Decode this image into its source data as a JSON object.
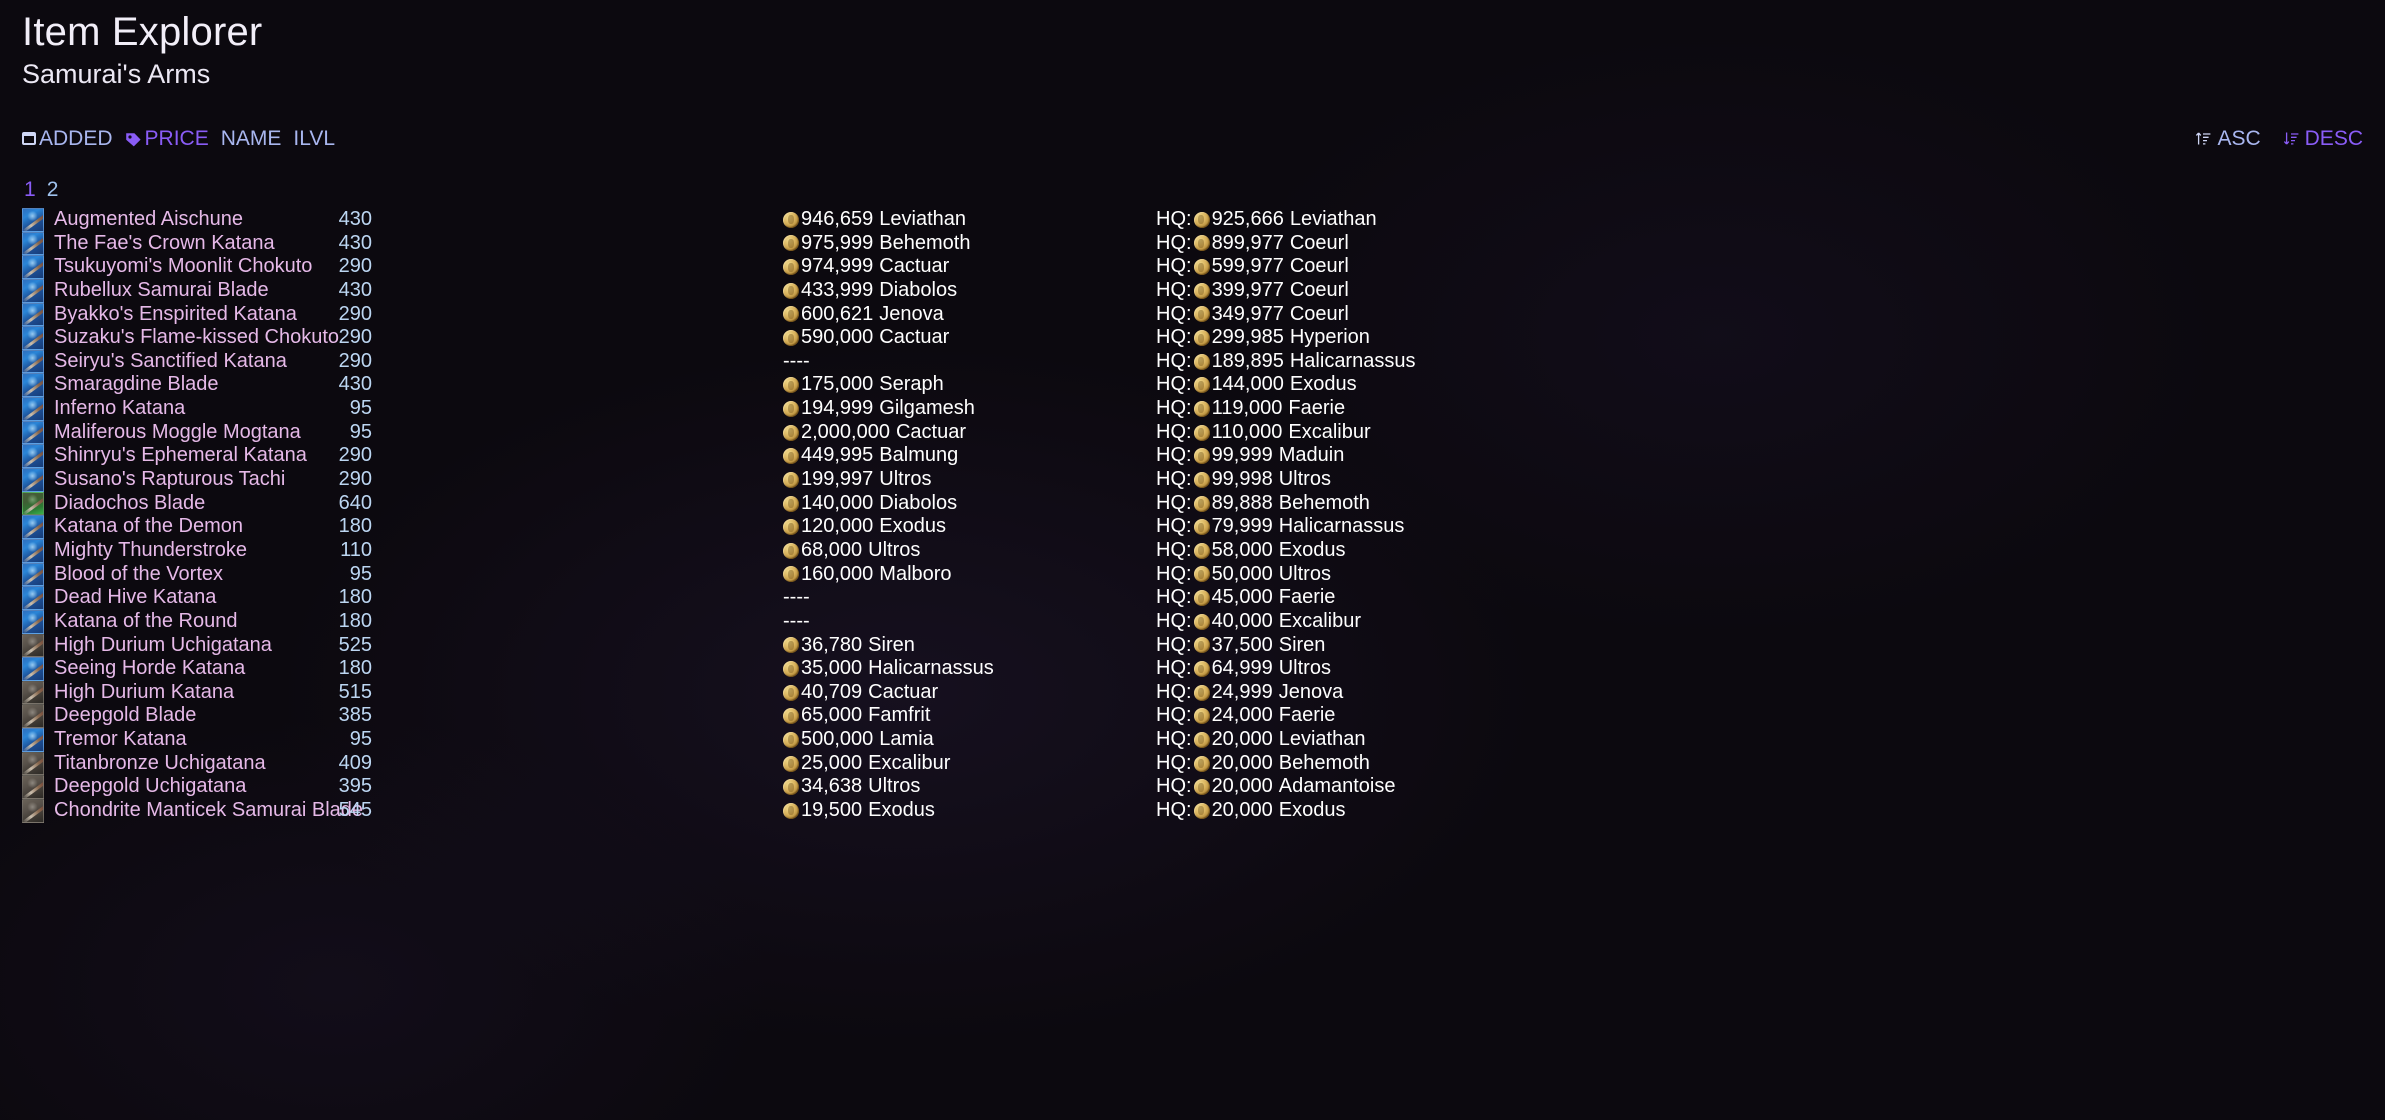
{
  "header": {
    "title": "Item Explorer",
    "subtitle": "Samurai's Arms"
  },
  "sort": {
    "options": [
      {
        "label": "ADDED",
        "icon": "calendar-icon",
        "active": false
      },
      {
        "label": "PRICE",
        "icon": "price-tag-icon",
        "active": true
      },
      {
        "label": "NAME",
        "icon": "",
        "active": false
      },
      {
        "label": "ILVL",
        "icon": "",
        "active": false
      }
    ],
    "directions": [
      {
        "label": "ASC",
        "icon": "sort-ascending-icon",
        "active": false
      },
      {
        "label": "DESC",
        "icon": "sort-descending-icon",
        "active": true
      }
    ]
  },
  "pagination": {
    "pages": [
      {
        "label": "1",
        "current": true
      },
      {
        "label": "2",
        "current": false
      }
    ]
  },
  "list": {
    "rows": [
      {
        "name": "Augmented Aischune",
        "ilvl": "430",
        "icon_tone": "blue",
        "price": {
          "value": "946,659",
          "server": "Leviathan"
        },
        "hq": {
          "prefix": "HQ:",
          "value": "925,666",
          "server": "Leviathan"
        }
      },
      {
        "name": "The Fae's Crown Katana",
        "ilvl": "430",
        "icon_tone": "blue",
        "price": {
          "value": "975,999",
          "server": "Behemoth"
        },
        "hq": {
          "prefix": "HQ:",
          "value": "899,977",
          "server": "Coeurl"
        }
      },
      {
        "name": "Tsukuyomi's Moonlit Chokuto",
        "ilvl": "290",
        "icon_tone": "blue",
        "price": {
          "value": "974,999",
          "server": "Cactuar"
        },
        "hq": {
          "prefix": "HQ:",
          "value": "599,977",
          "server": "Coeurl"
        }
      },
      {
        "name": "Rubellux Samurai Blade",
        "ilvl": "430",
        "icon_tone": "blue",
        "price": {
          "value": "433,999",
          "server": "Diabolos"
        },
        "hq": {
          "prefix": "HQ:",
          "value": "399,977",
          "server": "Coeurl"
        }
      },
      {
        "name": "Byakko's Enspirited Katana",
        "ilvl": "290",
        "icon_tone": "blue",
        "price": {
          "value": "600,621",
          "server": "Jenova"
        },
        "hq": {
          "prefix": "HQ:",
          "value": "349,977",
          "server": "Coeurl"
        }
      },
      {
        "name": "Suzaku's Flame-kissed Chokuto",
        "ilvl": "290",
        "icon_tone": "blue",
        "price": {
          "value": "590,000",
          "server": "Cactuar"
        },
        "hq": {
          "prefix": "HQ:",
          "value": "299,985",
          "server": "Hyperion"
        }
      },
      {
        "name": "Seiryu's Sanctified Katana",
        "ilvl": "290",
        "icon_tone": "blue",
        "price": {
          "empty": "----"
        },
        "hq": {
          "prefix": "HQ:",
          "value": "189,895",
          "server": "Halicarnassus"
        }
      },
      {
        "name": "Smaragdine Blade",
        "ilvl": "430",
        "icon_tone": "blue",
        "price": {
          "value": "175,000",
          "server": "Seraph"
        },
        "hq": {
          "prefix": "HQ:",
          "value": "144,000",
          "server": "Exodus"
        }
      },
      {
        "name": "Inferno Katana",
        "ilvl": "95",
        "icon_tone": "blue",
        "price": {
          "value": "194,999",
          "server": "Gilgamesh"
        },
        "hq": {
          "prefix": "HQ:",
          "value": "119,000",
          "server": "Faerie"
        }
      },
      {
        "name": "Maliferous Moggle Mogtana",
        "ilvl": "95",
        "icon_tone": "blue",
        "price": {
          "value": "2,000,000",
          "server": "Cactuar"
        },
        "hq": {
          "prefix": "HQ:",
          "value": "110,000",
          "server": "Excalibur"
        }
      },
      {
        "name": "Shinryu's Ephemeral Katana",
        "ilvl": "290",
        "icon_tone": "blue",
        "price": {
          "value": "449,995",
          "server": "Balmung"
        },
        "hq": {
          "prefix": "HQ:",
          "value": "99,999",
          "server": "Maduin"
        }
      },
      {
        "name": "Susano's Rapturous Tachi",
        "ilvl": "290",
        "icon_tone": "blue",
        "price": {
          "value": "199,997",
          "server": "Ultros"
        },
        "hq": {
          "prefix": "HQ:",
          "value": "99,998",
          "server": "Ultros"
        }
      },
      {
        "name": "Diadochos Blade",
        "ilvl": "640",
        "icon_tone": "green",
        "price": {
          "value": "140,000",
          "server": "Diabolos"
        },
        "hq": {
          "prefix": "HQ:",
          "value": "89,888",
          "server": "Behemoth"
        }
      },
      {
        "name": "Katana of the Demon",
        "ilvl": "180",
        "icon_tone": "blue",
        "price": {
          "value": "120,000",
          "server": "Exodus"
        },
        "hq": {
          "prefix": "HQ:",
          "value": "79,999",
          "server": "Halicarnassus"
        }
      },
      {
        "name": "Mighty Thunderstroke",
        "ilvl": "110",
        "icon_tone": "blue",
        "price": {
          "value": "68,000",
          "server": "Ultros"
        },
        "hq": {
          "prefix": "HQ:",
          "value": "58,000",
          "server": "Exodus"
        }
      },
      {
        "name": "Blood of the Vortex",
        "ilvl": "95",
        "icon_tone": "blue",
        "price": {
          "value": "160,000",
          "server": "Malboro"
        },
        "hq": {
          "prefix": "HQ:",
          "value": "50,000",
          "server": "Ultros"
        }
      },
      {
        "name": "Dead Hive Katana",
        "ilvl": "180",
        "icon_tone": "blue",
        "price": {
          "empty": "----"
        },
        "hq": {
          "prefix": "HQ:",
          "value": "45,000",
          "server": "Faerie"
        }
      },
      {
        "name": "Katana of the Round",
        "ilvl": "180",
        "icon_tone": "blue",
        "price": {
          "empty": "----"
        },
        "hq": {
          "prefix": "HQ:",
          "value": "40,000",
          "server": "Excalibur"
        }
      },
      {
        "name": "High Durium Uchigatana",
        "ilvl": "525",
        "icon_tone": "gray",
        "price": {
          "value": "36,780",
          "server": "Siren"
        },
        "hq": {
          "prefix": "HQ:",
          "value": "37,500",
          "server": "Siren"
        }
      },
      {
        "name": "Seeing Horde Katana",
        "ilvl": "180",
        "icon_tone": "blue",
        "price": {
          "value": "35,000",
          "server": "Halicarnassus"
        },
        "hq": {
          "prefix": "HQ:",
          "value": "64,999",
          "server": "Ultros"
        }
      },
      {
        "name": "High Durium Katana",
        "ilvl": "515",
        "icon_tone": "gray",
        "price": {
          "value": "40,709",
          "server": "Cactuar"
        },
        "hq": {
          "prefix": "HQ:",
          "value": "24,999",
          "server": "Jenova"
        }
      },
      {
        "name": "Deepgold Blade",
        "ilvl": "385",
        "icon_tone": "gray",
        "price": {
          "value": "65,000",
          "server": "Famfrit"
        },
        "hq": {
          "prefix": "HQ:",
          "value": "24,000",
          "server": "Faerie"
        }
      },
      {
        "name": "Tremor Katana",
        "ilvl": "95",
        "icon_tone": "blue",
        "price": {
          "value": "500,000",
          "server": "Lamia"
        },
        "hq": {
          "prefix": "HQ:",
          "value": "20,000",
          "server": "Leviathan"
        }
      },
      {
        "name": "Titanbronze Uchigatana",
        "ilvl": "409",
        "icon_tone": "gray",
        "price": {
          "value": "25,000",
          "server": "Excalibur"
        },
        "hq": {
          "prefix": "HQ:",
          "value": "20,000",
          "server": "Behemoth"
        }
      },
      {
        "name": "Deepgold Uchigatana",
        "ilvl": "395",
        "icon_tone": "gray",
        "price": {
          "value": "34,638",
          "server": "Ultros"
        },
        "hq": {
          "prefix": "HQ:",
          "value": "20,000",
          "server": "Adamantoise"
        }
      },
      {
        "name": "Chondrite Manticek Samurai Blade",
        "ilvl": "545",
        "icon_tone": "gray",
        "price": {
          "value": "19,500",
          "server": "Exodus"
        },
        "hq": {
          "prefix": "HQ:",
          "value": "20,000",
          "server": "Exodus"
        }
      }
    ]
  },
  "colors": {
    "background": "#0c090f",
    "accent_purple": "#8a5cf6",
    "link_blue": "#a9b6ef",
    "item_name": "#e6b9e8",
    "ilvl": "#bcd6f2",
    "price_white": "#ffffff",
    "gil_coin": "#d9b25c"
  }
}
